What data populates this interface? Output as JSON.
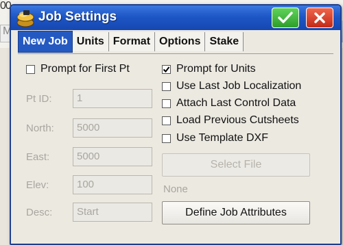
{
  "background": {
    "fragment_top": "00",
    "fragment_field": "M"
  },
  "dialog": {
    "title": "Job Settings",
    "ok_icon": "checkmark-icon",
    "close_icon": "x-icon",
    "colors": {
      "titlebar": "#1e56c6",
      "ok": "#2e9e2b",
      "close": "#c22a17",
      "active_tab": "#2559c2"
    }
  },
  "tabs": [
    {
      "label": "New Job",
      "active": true
    },
    {
      "label": "Units"
    },
    {
      "label": "Format"
    },
    {
      "label": "Options"
    },
    {
      "label": "Stake"
    }
  ],
  "left": {
    "prompt_first_pt": {
      "label": "Prompt for First Pt",
      "checked": false
    },
    "fields": [
      {
        "label": "Pt ID:",
        "value": "1"
      },
      {
        "label": "North:",
        "value": "5000"
      },
      {
        "label": "East:",
        "value": "5000"
      },
      {
        "label": "Elev:",
        "value": "100"
      },
      {
        "label": "Desc:",
        "value": "Start"
      }
    ]
  },
  "right": {
    "checkboxes": [
      {
        "label": "Prompt for Units",
        "checked": true
      },
      {
        "label": "Use Last Job Localization",
        "checked": false
      },
      {
        "label": "Attach Last Control Data",
        "checked": false
      },
      {
        "label": "Load Previous Cutsheets",
        "checked": false
      },
      {
        "label": "Use Template DXF",
        "checked": false
      }
    ],
    "select_file": "Select File",
    "template_name": "None",
    "define_attributes": "Define Job Attributes"
  }
}
